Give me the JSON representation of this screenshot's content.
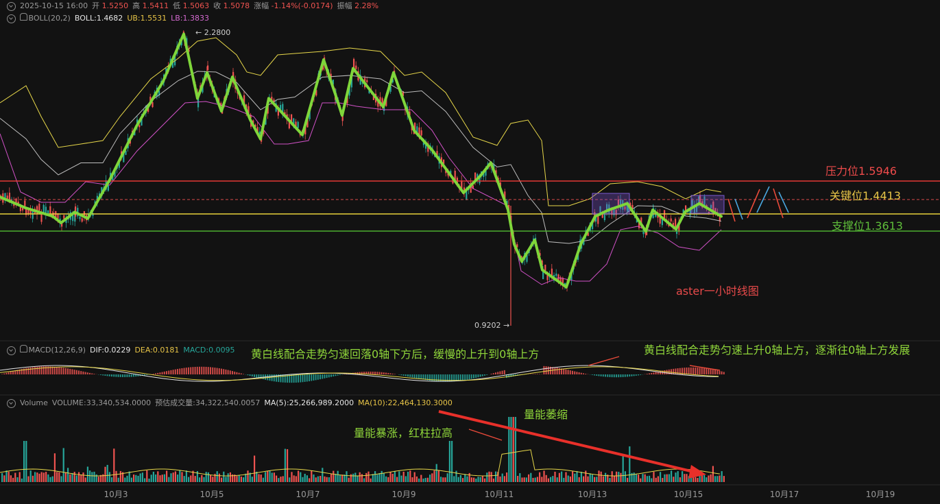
{
  "header": {
    "datetime": "2025-10-15 16:00",
    "open_label": "开",
    "open": "1.5250",
    "high_label": "高",
    "high": "1.5411",
    "low_label": "低",
    "low": "1.5063",
    "close_label": "收",
    "close": "1.5078",
    "change_label": "涨幅",
    "change": "-1.14%(-0.0174)",
    "amplitude_label": "振幅",
    "amplitude": "2.28%"
  },
  "boll": {
    "name": "BOLL(20,2)",
    "boll": "BOLL:1.4682",
    "ub": "UB:1.5531",
    "lb": "LB:1.3833"
  },
  "macd": {
    "name": "MACD(12,26,9)",
    "dif": "DIF:0.0229",
    "dea": "DEA:0.0181",
    "macd": "MACD:0.0095"
  },
  "volume": {
    "name": "Volume",
    "volume": "VOLUME:33,340,534.0000",
    "est": "预估成交量:34,322,540.0057",
    "ma5": "MA(5):25,266,989.2000",
    "ma10": "MA(10):22,464,130.3000"
  },
  "levels": {
    "resistance": "压力位1.5946",
    "key": "关键位1.4413",
    "support": "支撑位1.3613"
  },
  "annotations": {
    "chart_title": "aster一小时线图",
    "macd_left": "黄白线配合走势匀速回落0轴下方后，缓慢的上升到0轴上方",
    "macd_right": "黄白线配合走势匀速上升0轴上方，逐渐往0轴上方发展",
    "vol_surge": "量能暴涨，红柱拉高",
    "vol_shrink": "量能萎缩"
  },
  "price_marks": {
    "high": "2.2800",
    "low": "0.9202"
  },
  "colors": {
    "up": "#26a69a",
    "down": "#ef5350",
    "boll_mid": "#bdbdbd",
    "ub": "#e8d84a",
    "lb": "#d252c8",
    "trend": "#7fd63a",
    "resistance": "#e53935",
    "key": "#e8d23a",
    "support": "#4caf2f"
  },
  "chart_data": {
    "type": "line",
    "x_ticks": [
      "10月3",
      "10月5",
      "10月7",
      "10月9",
      "10月11",
      "10月13",
      "10月15",
      "10月17",
      "10月19"
    ],
    "horizontal_levels": [
      1.5946,
      1.4413,
      1.3613
    ],
    "trend_path_prices": [
      1.52,
      1.47,
      1.43,
      1.4,
      1.45,
      1.42,
      1.6,
      1.85,
      2.06,
      2.28,
      1.98,
      2.1,
      1.92,
      2.08,
      1.88,
      1.79,
      1.98,
      1.81,
      2.16,
      2.0,
      1.9,
      2.12,
      1.94,
      2.1,
      1.83,
      1.74,
      1.64,
      1.54,
      1.62,
      1.68,
      1.46,
      1.3,
      1.22,
      1.32,
      1.18,
      1.1,
      1.3,
      1.43,
      1.46,
      1.49,
      1.36,
      1.46,
      1.37,
      1.45,
      1.49,
      1.43
    ],
    "price_high": 2.28,
    "price_low": 0.9202
  }
}
